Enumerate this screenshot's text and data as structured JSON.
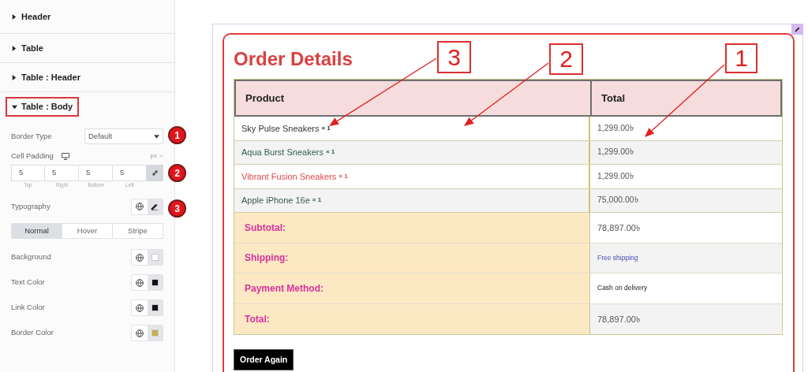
{
  "sidebar": {
    "sections": [
      {
        "label": "Header",
        "expanded": false
      },
      {
        "label": "Table",
        "expanded": false
      },
      {
        "label": "Table : Header",
        "expanded": false
      },
      {
        "label": "Table : Body",
        "expanded": true
      }
    ],
    "border_type": {
      "label": "Border Type",
      "value": "Default",
      "badge": "1"
    },
    "cell_padding": {
      "label": "Cell Padding",
      "unit": "px",
      "badge": "2",
      "linked": true,
      "fields": [
        {
          "value": "5",
          "caption": "Top"
        },
        {
          "value": "5",
          "caption": "Right"
        },
        {
          "value": "5",
          "caption": "Bottom"
        },
        {
          "value": "5",
          "caption": "Left"
        }
      ]
    },
    "typography": {
      "label": "Typography",
      "badge": "3"
    },
    "state_tabs": [
      {
        "label": "Normal",
        "selected": true
      },
      {
        "label": "Hover",
        "selected": false
      },
      {
        "label": "Stripe",
        "selected": false
      }
    ],
    "colors": [
      {
        "label": "Background",
        "color": "#ffffff"
      },
      {
        "label": "Text Color",
        "color": "#111111"
      },
      {
        "label": "Link Color",
        "color": "#111111"
      },
      {
        "label": "Border Color",
        "color": "#c4b24a"
      }
    ]
  },
  "order": {
    "title": "Order Details",
    "columns": [
      "Product",
      "Total"
    ],
    "items": [
      {
        "name": "Sky Pulse Sneakers",
        "qty": "× 1",
        "total": "1,299.00৳",
        "color": "#333333"
      },
      {
        "name": "Aqua Burst Sneakers",
        "qty": "× 1",
        "total": "1,299.00৳",
        "color": "#2e5e52"
      },
      {
        "name": "Vibrant Fusion Sneakers",
        "qty": "× 1",
        "total": "1,299.00৳",
        "color": "#e04848"
      },
      {
        "name": "Apple iPhone 16e",
        "qty": "× 1",
        "total": "75,000.00৳",
        "color": "#3a5a50"
      }
    ],
    "totals": [
      {
        "label": "Subtotal:",
        "value": "78,897.00৳",
        "kind": "amount"
      },
      {
        "label": "Shipping:",
        "value": "Free shipping",
        "kind": "link"
      },
      {
        "label": "Payment Method:",
        "value": "Cash on delivery",
        "kind": "note"
      },
      {
        "label": "Total:",
        "value": "78,897.00৳",
        "kind": "amount"
      }
    ],
    "button": "Order Again"
  },
  "callouts": [
    "3",
    "2",
    "1"
  ]
}
